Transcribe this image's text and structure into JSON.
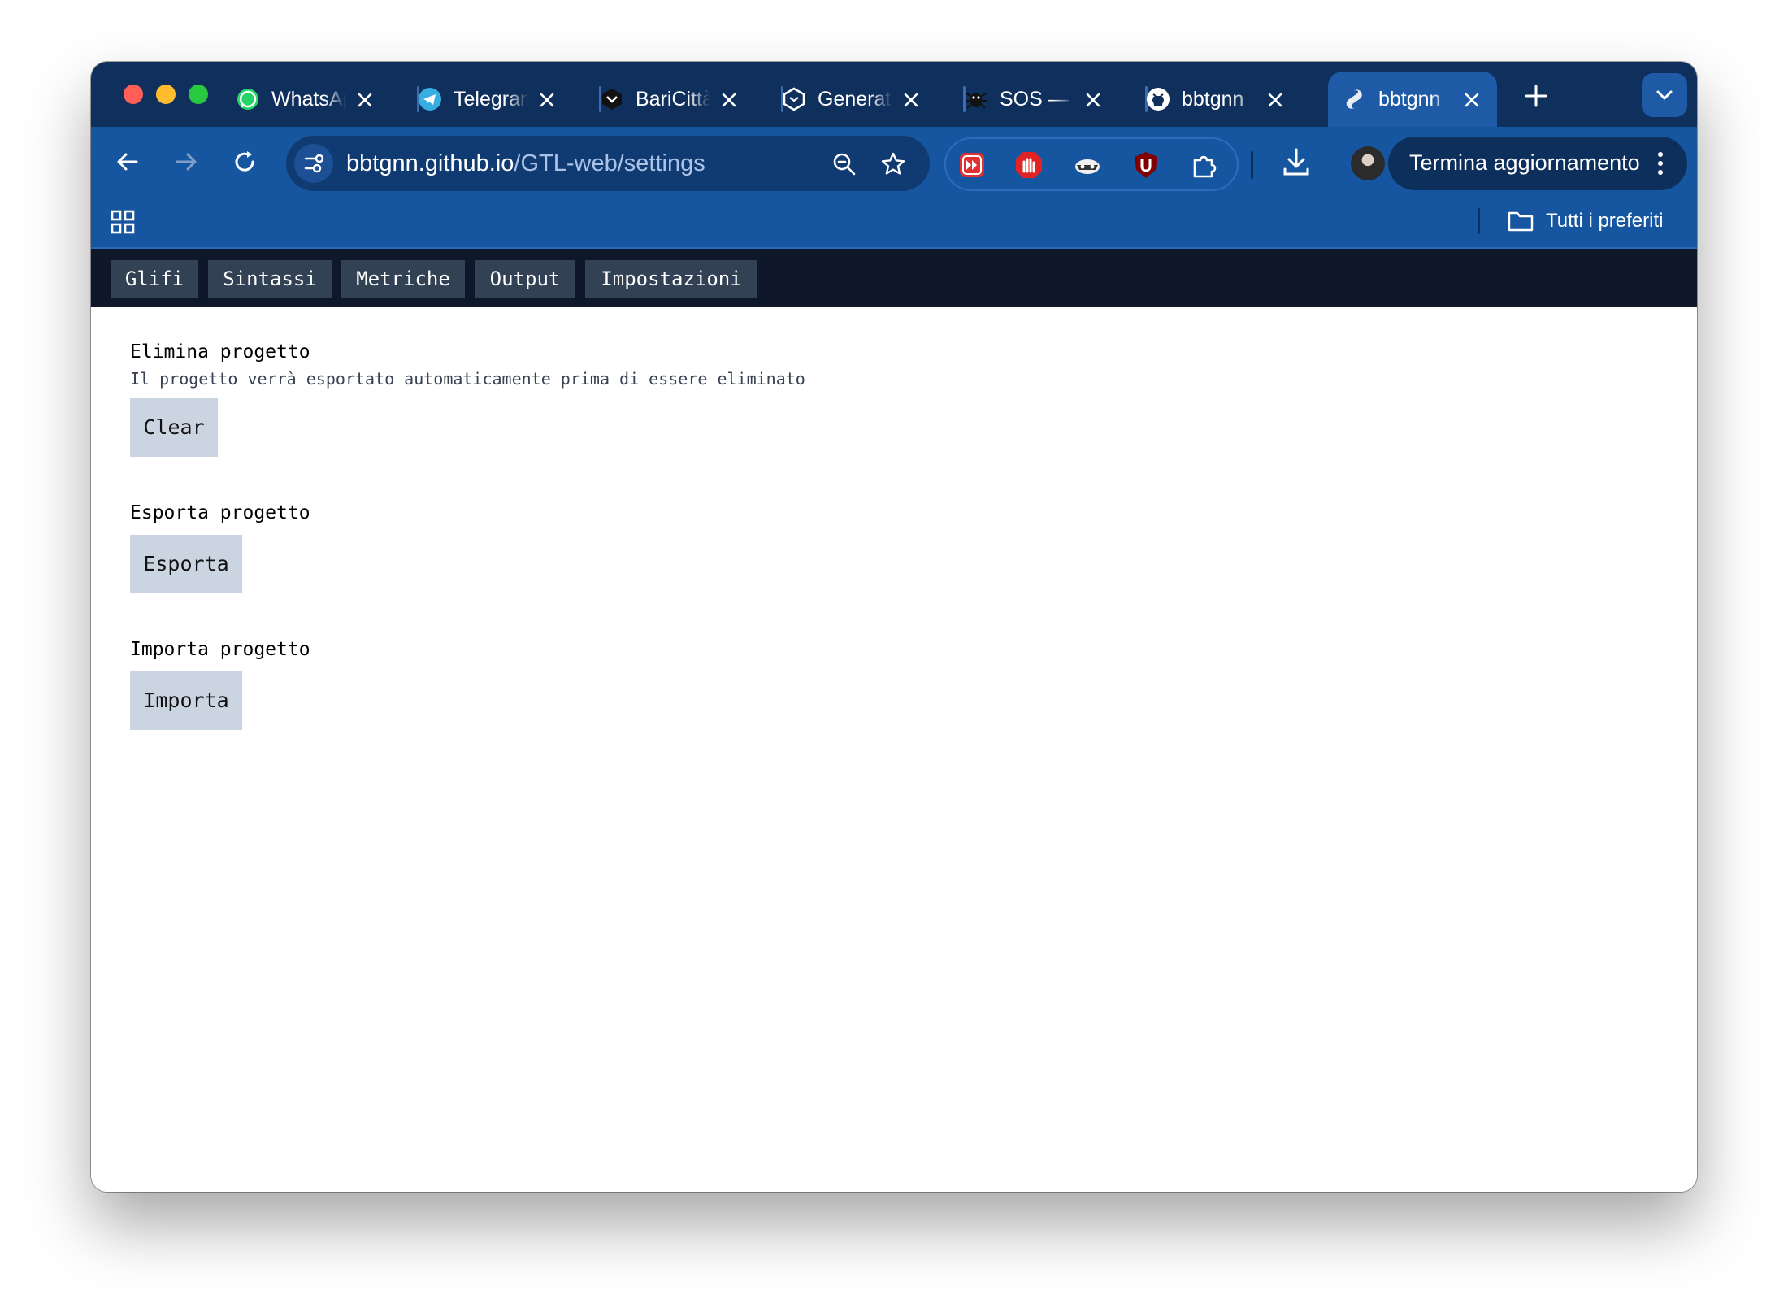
{
  "browser": {
    "tabs": [
      {
        "title": "WhatsApp",
        "icon": "whatsapp-icon"
      },
      {
        "title": "Telegram",
        "icon": "telegram-icon"
      },
      {
        "title": "BariCittà",
        "icon": "baricitta-icon"
      },
      {
        "title": "Generate",
        "icon": "hexagon-icon"
      },
      {
        "title": "SOS —",
        "icon": "bug-icon"
      },
      {
        "title": "bbtgnn",
        "icon": "github-icon"
      },
      {
        "title": "bbtgnn",
        "icon": "svelte-icon",
        "active": true
      }
    ],
    "url_host": "bbtgnn.github.io",
    "url_path": "/GTL-web/settings",
    "update_button": "Termina aggiornamento",
    "bookmarks_folder": "Tutti i preferiti",
    "colors": {
      "tabstrip": "#0f2f5c",
      "toolbar": "#1656a0",
      "active_tab": "#1e5aa6"
    }
  },
  "app": {
    "nav": [
      "Glifi",
      "Sintassi",
      "Metriche",
      "Output",
      "Impostazioni"
    ],
    "sections": {
      "delete": {
        "title": "Elimina progetto",
        "subtitle": "Il progetto verrà esportato automaticamente prima di essere eliminato",
        "button": "Clear"
      },
      "export": {
        "title": "Esporta progetto",
        "button": "Esporta"
      },
      "import": {
        "title": "Importa progetto",
        "button": "Importa"
      }
    },
    "colors": {
      "nav_bg": "#0f172a",
      "nav_tab": "#334155",
      "button_bg": "#cbd5e1"
    }
  }
}
